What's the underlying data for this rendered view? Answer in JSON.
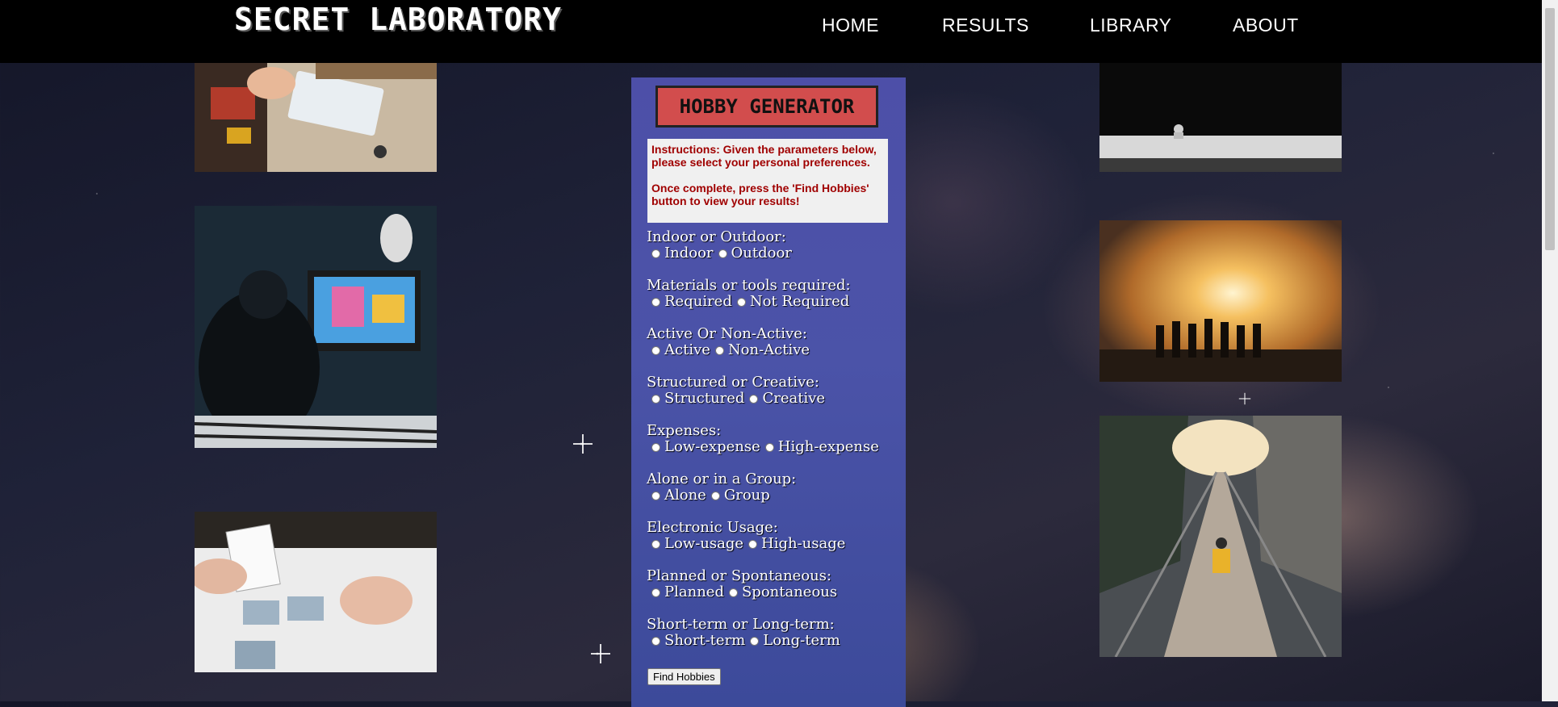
{
  "nav": {
    "logo": "SECRET LABORATORY",
    "links": [
      "HOME",
      "RESULTS",
      "LIBRARY",
      "ABOUT"
    ]
  },
  "panel": {
    "title": "HOBBY GENERATOR",
    "instructions_1": "Instructions: Given the parameters below, please select your personal preferences.",
    "instructions_2": "Once complete, press the 'Find Hobbies' button to view your results!",
    "questions": [
      {
        "label": "Indoor or Outdoor:",
        "options": [
          "Indoor",
          "Outdoor"
        ]
      },
      {
        "label": "Materials or tools required:",
        "options": [
          "Required",
          "Not Required"
        ]
      },
      {
        "label": "Active Or Non-Active:",
        "options": [
          "Active",
          "Non-Active"
        ]
      },
      {
        "label": "Structured or Creative:",
        "options": [
          "Structured",
          "Creative"
        ]
      },
      {
        "label": "Expenses:",
        "options": [
          "Low-expense",
          "High-expense"
        ]
      },
      {
        "label": "Alone or in a Group:",
        "options": [
          "Alone",
          "Group"
        ]
      },
      {
        "label": "Electronic Usage:",
        "options": [
          "Low-usage",
          "High-usage"
        ]
      },
      {
        "label": "Planned or Spontaneous:",
        "options": [
          "Planned",
          "Spontaneous"
        ]
      },
      {
        "label": "Short-term or Long-term:",
        "options": [
          "Short-term",
          "Long-term"
        ]
      }
    ],
    "submit_label": "Find Hobbies"
  }
}
